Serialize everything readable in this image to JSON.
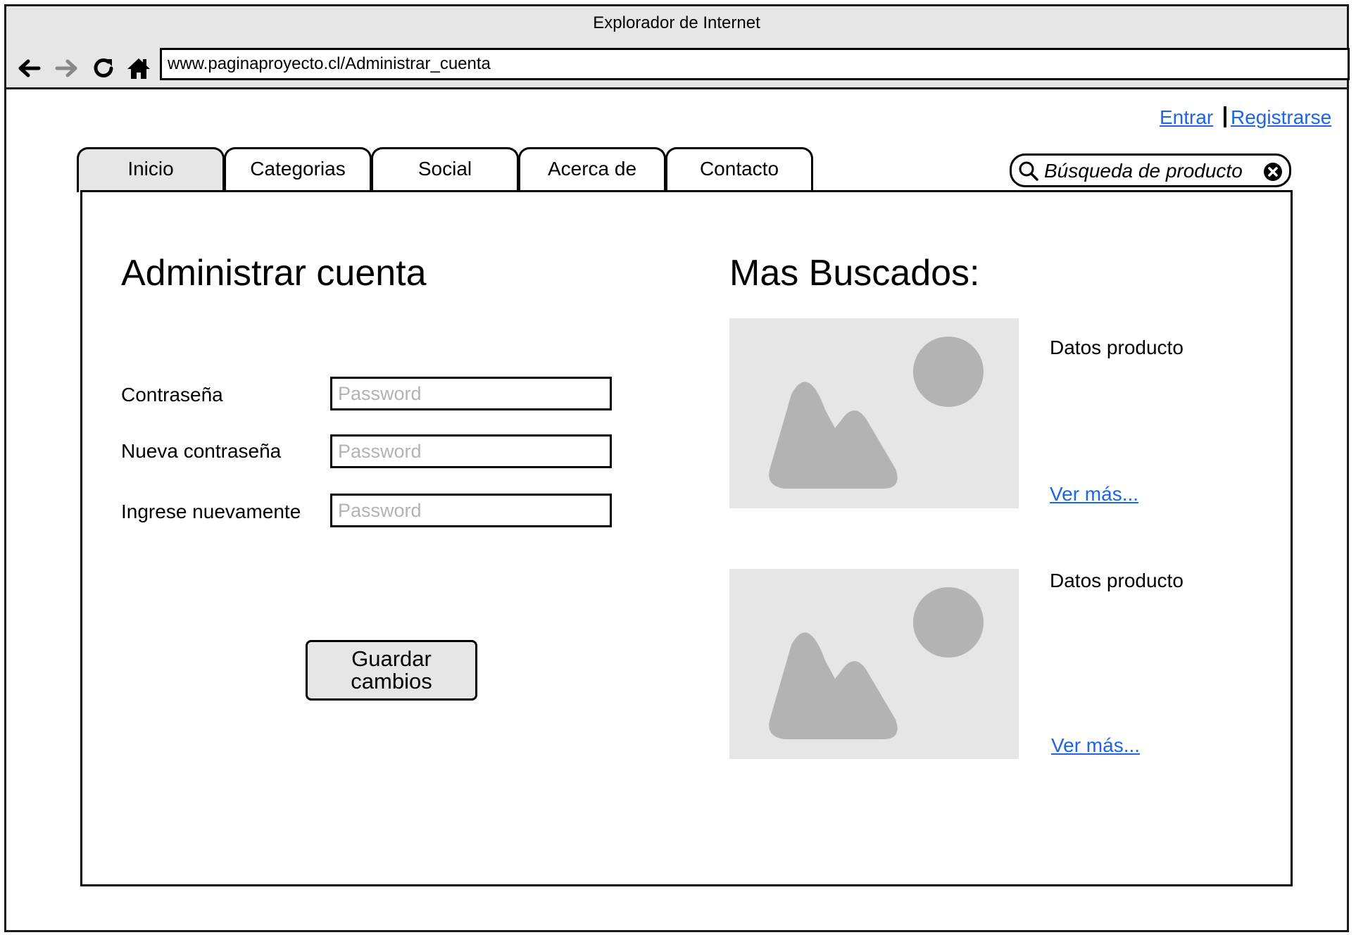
{
  "browser": {
    "window_title": "Explorador de Internet",
    "url": "www.paginaproyecto.cl/Administrar_cuenta"
  },
  "auth": {
    "login": "Entrar",
    "register": "Registrarse"
  },
  "tabs": [
    {
      "label": "Inicio",
      "active": true
    },
    {
      "label": "Categorias",
      "active": false
    },
    {
      "label": "Social",
      "active": false
    },
    {
      "label": "Acerca de",
      "active": false
    },
    {
      "label": "Contacto",
      "active": false
    }
  ],
  "search": {
    "placeholder": "Búsqueda de producto"
  },
  "account": {
    "title": "Administrar cuenta",
    "fields": [
      {
        "label": "Contraseña",
        "placeholder": "Password"
      },
      {
        "label": "Nueva contraseña",
        "placeholder": "Password"
      },
      {
        "label": "Ingrese nuevamente",
        "placeholder": "Password"
      }
    ],
    "save_button": "Guardar\ncambios"
  },
  "most_searched": {
    "title": "Mas Buscados:",
    "products": [
      {
        "data_label": "Datos producto",
        "more_link": "Ver más..."
      },
      {
        "data_label": "Datos producto",
        "more_link": "Ver más..."
      }
    ]
  },
  "colors": {
    "link": "#1a66e6",
    "chrome": "#e6e6e6",
    "placeholder_image": "#e6e6e6",
    "placeholder_shape": "#b3b3b3"
  }
}
